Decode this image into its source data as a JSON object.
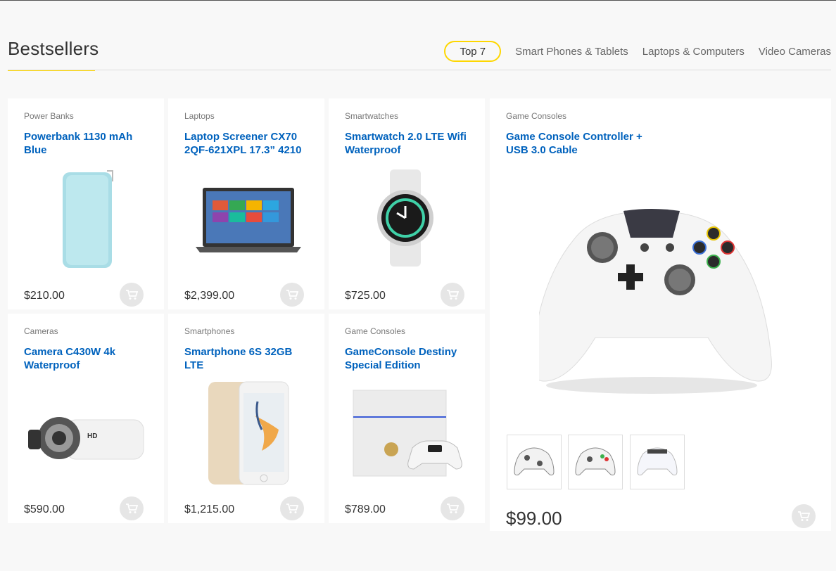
{
  "header": {
    "title": "Bestsellers",
    "tabs": [
      "Top 7",
      "Smart Phones & Tablets",
      "Laptops & Computers",
      "Video Cameras"
    ]
  },
  "products": [
    {
      "category": "Power Banks",
      "name": "Powerbank 1130 mAh Blue",
      "price": "$210.00"
    },
    {
      "category": "Laptops",
      "name": "Laptop Screener CX70 2QF-621XPL 17.3” 4210",
      "price": "$2,399.00"
    },
    {
      "category": "Smartwatches",
      "name": "Smartwatch 2.0 LTE Wifi Waterproof",
      "price": "$725.00"
    },
    {
      "category": "Cameras",
      "name": "Camera C430W 4k Waterproof",
      "price": "$590.00"
    },
    {
      "category": "Smartphones",
      "name": "Smartphone 6S 32GB LTE",
      "price": "$1,215.00"
    },
    {
      "category": "Game Consoles",
      "name": "GameConsole Destiny Special Edition",
      "price": "$789.00"
    }
  ],
  "featured": {
    "category": "Game Consoles",
    "name": "Game Console Controller + USB 3.0 Cable",
    "price": "$99.00"
  },
  "colors": {
    "accent": "#fed700",
    "link": "#0062bd"
  }
}
